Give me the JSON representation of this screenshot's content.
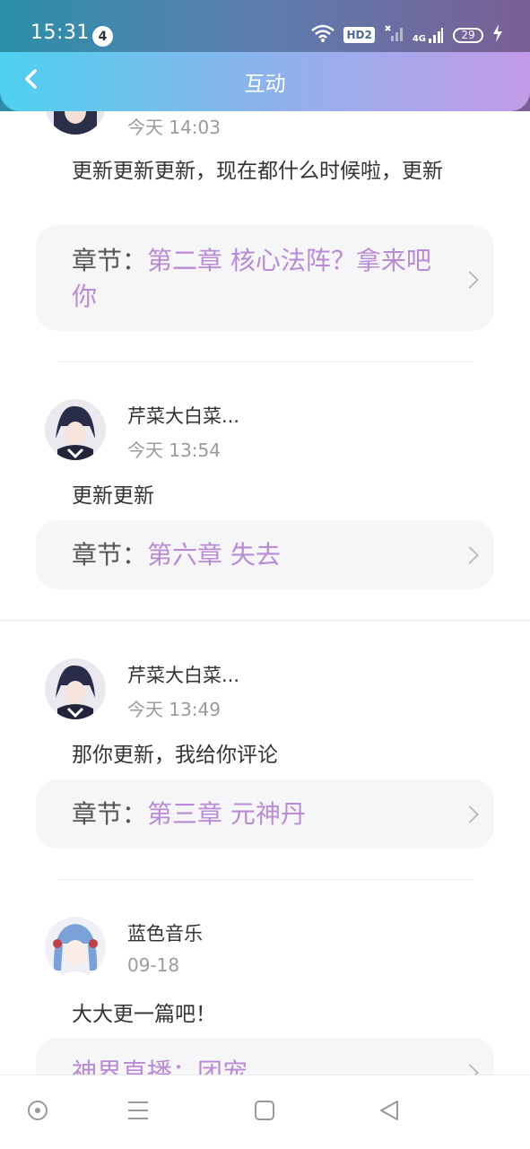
{
  "status_bar": {
    "time": "15:31",
    "notification_count": "4",
    "hd_label": "HD2",
    "network_label": "4G",
    "battery_level": "29",
    "icons": [
      "wifi-icon",
      "hd-icon",
      "signal-icon",
      "battery-icon",
      "charging-icon"
    ]
  },
  "header": {
    "title": "互动",
    "back_icon": "chevron-left-icon"
  },
  "comments": [
    {
      "username": "",
      "time": "今天 14:03",
      "text": "更新更新更新，现在都什么时候啦，更新",
      "chapter_prefix": "章节：",
      "chapter_name": "第二章  核心法阵？拿来吧你"
    },
    {
      "username": "芹菜大白菜...",
      "time": "今天 13:54",
      "text": "更新更新",
      "chapter_prefix": "章节：",
      "chapter_name": "第六章  失去"
    },
    {
      "username": "芹菜大白菜...",
      "time": "今天 13:49",
      "text": "那你更新，我给你评论",
      "chapter_prefix": "章节：",
      "chapter_name": "第三章  元神丹"
    },
    {
      "username": "蓝色音乐",
      "time": "09-18",
      "text": "大大更一篇吧！",
      "chapter_prefix": "",
      "chapter_name": "神界直播：团宠"
    }
  ],
  "nav_bar": {
    "icons": [
      "home-circle-icon",
      "menu-icon",
      "square-icon",
      "back-triangle-icon"
    ]
  },
  "colors": {
    "accent": "#b98bd6",
    "header_start": "#4fd1f0",
    "header_end": "#c39be8"
  }
}
